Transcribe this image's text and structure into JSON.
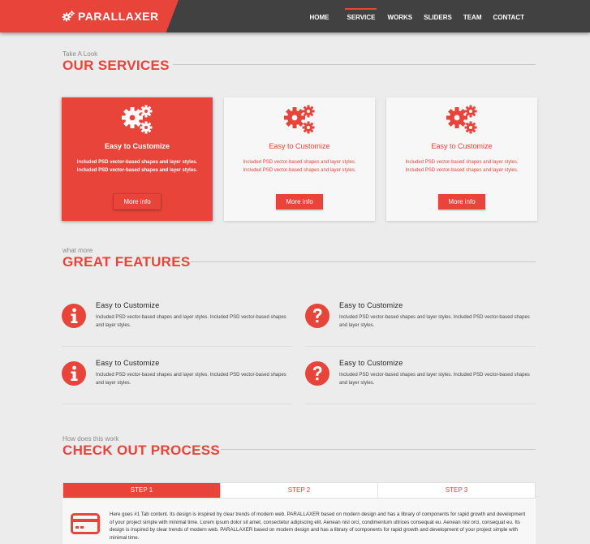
{
  "brand": {
    "name": "PARALLAXER",
    "accent": "#e8443a",
    "header_bg": "#414141"
  },
  "nav": [
    {
      "label": "HOME",
      "active": false
    },
    {
      "label": "SERVICE",
      "active": true
    },
    {
      "label": "WORKS",
      "active": false
    },
    {
      "label": "SLIDERS",
      "active": false
    },
    {
      "label": "TEAM",
      "active": false
    },
    {
      "label": "CONTACT",
      "active": false
    }
  ],
  "services": {
    "subtitle": "Take A Look",
    "title": "OUR SERVICES",
    "cards": [
      {
        "icon": "gears-icon",
        "title": "Easy to Customize",
        "desc": "Included PSD vector-based shapes and layer styles. Included PSD vector-based shapes and layer styles.",
        "button": "More info",
        "active": true
      },
      {
        "icon": "gears-icon",
        "title": "Easy to Customize",
        "desc": "Included PSD vector-based shapes and layer styles. Included PSD vector-based shapes and layer styles.",
        "button": "More info",
        "active": false
      },
      {
        "icon": "gears-icon",
        "title": "Easy to Customize",
        "desc": "Included PSD vector-based shapes and layer styles. Included PSD vector-based shapes and layer styles.",
        "button": "More info",
        "active": false
      }
    ]
  },
  "features": {
    "subtitle": "what more",
    "title": "GREAT FEATURES",
    "items": [
      {
        "icon": "info-icon",
        "title": "Easy to Customize",
        "desc": "Included PSD vector-based shapes and layer styles. Included PSD vector-based shapes and layer styles."
      },
      {
        "icon": "question-icon",
        "title": "Easy to Customize",
        "desc": "Included PSD vector-based shapes and layer styles. Included PSD vector-based shapes and layer styles."
      },
      {
        "icon": "info-icon",
        "title": "Easy to Customize",
        "desc": "Included PSD vector-based shapes and layer styles. Included PSD vector-based shapes and layer styles."
      },
      {
        "icon": "question-icon",
        "title": "Easy to Customize",
        "desc": "Included PSD vector-based shapes and layer styles. Included PSD vector-based shapes and layer styles."
      }
    ]
  },
  "process": {
    "subtitle": "How does this work",
    "title": "CHECK OUT PROCESS",
    "tabs": [
      {
        "label": "STEP 1",
        "active": true
      },
      {
        "label": "STEP 2",
        "active": false
      },
      {
        "label": "STEP 3",
        "active": false
      }
    ],
    "panel_icon": "credit-card-icon",
    "panel_text": "Here goes #1 Tab content. Its design is inspired by clear trends of modern web. PARALLAXER based on modern design and has a library of components for rapid growth and development of your project simple with minimal time. Lorem ipsum dolor sit amet, consectetur adipiscing elit. Aenean nisl orci, condimentum ultrices consequat eu. Aenean nisl orci, consequat eu. Its design is inspired by clear trends of modern web. PARALLAXER based on modern design and has a library of components for rapid growth and development of your project simple with minimal time."
  }
}
